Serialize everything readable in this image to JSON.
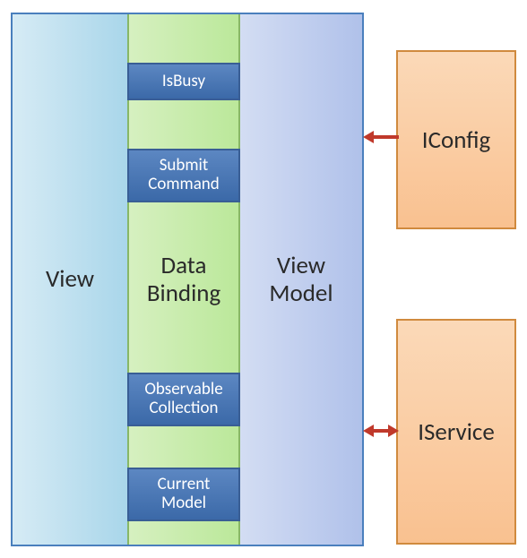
{
  "columns": {
    "view_label": "View",
    "binding_label": "Data\nBinding",
    "viewmodel_label": "View\nModel"
  },
  "binding_properties": [
    "IsBusy",
    "Submit\nCommand",
    "Observable\nCollection",
    "Current\nModel"
  ],
  "externals": {
    "config_label": "IConfig",
    "service_label": "IService"
  },
  "arrows": {
    "config": {
      "bidirectional": false,
      "direction": "left"
    },
    "service": {
      "bidirectional": true
    }
  },
  "colors": {
    "view_bg": "#a9d6ea",
    "binding_bg": "#bbe89a",
    "vm_bg": "#b0c1ea",
    "prop_bg": "#3b69a8",
    "ext_bg": "#f9c190",
    "arrow": "#c0392b",
    "main_border": "#4a7fbd",
    "ext_border": "#d08a3e"
  }
}
